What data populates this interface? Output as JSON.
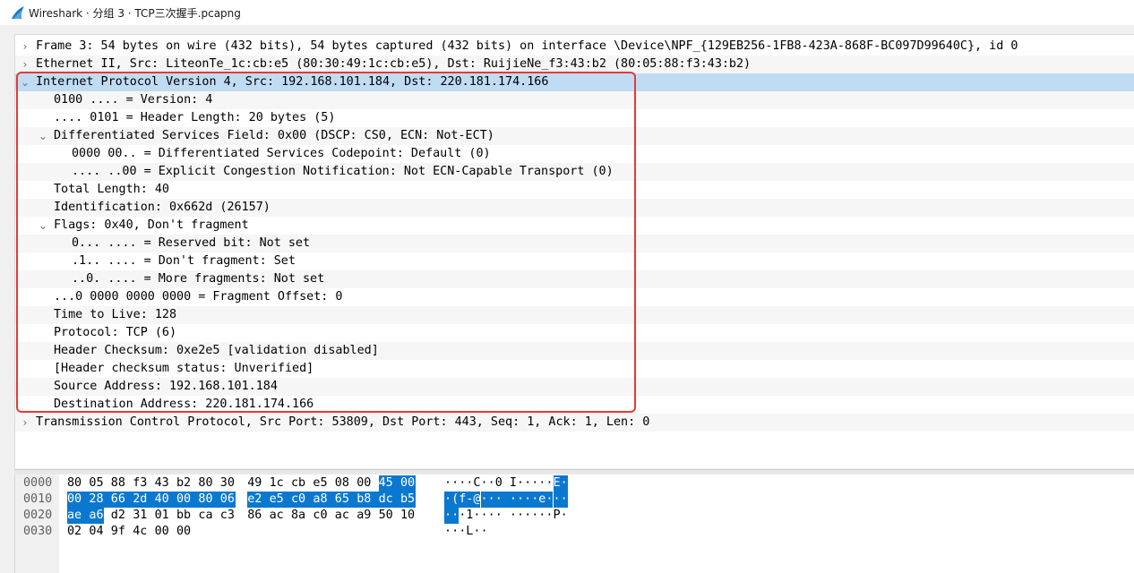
{
  "window": {
    "title": "Wireshark · 分组 3 · TCP三次握手.pcapng"
  },
  "details": {
    "rows": [
      {
        "indent": 0,
        "arrow": "›",
        "text": "Frame 3: 54 bytes on wire (432 bits), 54 bytes captured (432 bits) on interface \\Device\\NPF_{129EB256-1FB8-423A-868F-BC097D99640C}, id 0",
        "state": "collapsed"
      },
      {
        "indent": 0,
        "arrow": "›",
        "text": "Ethernet II, Src: LiteonTe_1c:cb:e5 (80:30:49:1c:cb:e5), Dst: RuijieNe_f3:43:b2 (80:05:88:f3:43:b2)",
        "state": "collapsed"
      },
      {
        "indent": 0,
        "arrow": "⌄",
        "text": "Internet Protocol Version 4, Src: 192.168.101.184, Dst: 220.181.174.166",
        "state": "expanded",
        "selected": true
      },
      {
        "indent": 1,
        "arrow": "",
        "text": "0100 .... = Version: 4"
      },
      {
        "indent": 1,
        "arrow": "",
        "text": ".... 0101 = Header Length: 20 bytes (5)"
      },
      {
        "indent": 1,
        "arrow": "⌄",
        "text": "Differentiated Services Field: 0x00 (DSCP: CS0, ECN: Not-ECT)",
        "state": "expanded"
      },
      {
        "indent": 2,
        "arrow": "",
        "text": "0000 00.. = Differentiated Services Codepoint: Default (0)"
      },
      {
        "indent": 2,
        "arrow": "",
        "text": ".... ..00 = Explicit Congestion Notification: Not ECN-Capable Transport (0)"
      },
      {
        "indent": 1,
        "arrow": "",
        "text": "Total Length: 40"
      },
      {
        "indent": 1,
        "arrow": "",
        "text": "Identification: 0x662d (26157)"
      },
      {
        "indent": 1,
        "arrow": "⌄",
        "text": "Flags: 0x40, Don't fragment",
        "state": "expanded"
      },
      {
        "indent": 2,
        "arrow": "",
        "text": "0... .... = Reserved bit: Not set"
      },
      {
        "indent": 2,
        "arrow": "",
        "text": ".1.. .... = Don't fragment: Set"
      },
      {
        "indent": 2,
        "arrow": "",
        "text": "..0. .... = More fragments: Not set"
      },
      {
        "indent": 1,
        "arrow": "",
        "text": "...0 0000 0000 0000 = Fragment Offset: 0"
      },
      {
        "indent": 1,
        "arrow": "",
        "text": "Time to Live: 128"
      },
      {
        "indent": 1,
        "arrow": "",
        "text": "Protocol: TCP (6)"
      },
      {
        "indent": 1,
        "arrow": "",
        "text": "Header Checksum: 0xe2e5 [validation disabled]"
      },
      {
        "indent": 1,
        "arrow": "",
        "text": "[Header checksum status: Unverified]"
      },
      {
        "indent": 1,
        "arrow": "",
        "text": "Source Address: 192.168.101.184"
      },
      {
        "indent": 1,
        "arrow": "",
        "text": "Destination Address: 220.181.174.166"
      },
      {
        "indent": 0,
        "arrow": "›",
        "text": "Transmission Control Protocol, Src Port: 53809, Dst Port: 443, Seq: 1, Ack: 1, Len: 0",
        "state": "collapsed"
      }
    ]
  },
  "bytes": {
    "rows": [
      {
        "offset": "0000",
        "hex": [
          "80",
          "05",
          "88",
          "f3",
          "43",
          "b2",
          "80",
          "30",
          "49",
          "1c",
          "cb",
          "e5",
          "08",
          "00",
          "45",
          "00"
        ],
        "ascii": "····C··0 I·····E·"
      },
      {
        "offset": "0010",
        "hex": [
          "00",
          "28",
          "66",
          "2d",
          "40",
          "00",
          "80",
          "06",
          "e2",
          "e5",
          "c0",
          "a8",
          "65",
          "b8",
          "dc",
          "b5"
        ],
        "ascii": "·(f-@··· ····e···"
      },
      {
        "offset": "0020",
        "hex": [
          "ae",
          "a6",
          "d2",
          "31",
          "01",
          "bb",
          "ca",
          "c3",
          "86",
          "ac",
          "8a",
          "c0",
          "ac",
          "a9",
          "50",
          "10"
        ],
        "ascii": "···1···· ······P·"
      },
      {
        "offset": "0030",
        "hex": [
          "02",
          "04",
          "9f",
          "4c",
          "00",
          "00"
        ],
        "ascii": "···L··"
      }
    ]
  },
  "colors": {
    "selected_row": "#c0dcf3",
    "byte_highlight": "#0b78d0",
    "annotation_box": "#e53935"
  }
}
